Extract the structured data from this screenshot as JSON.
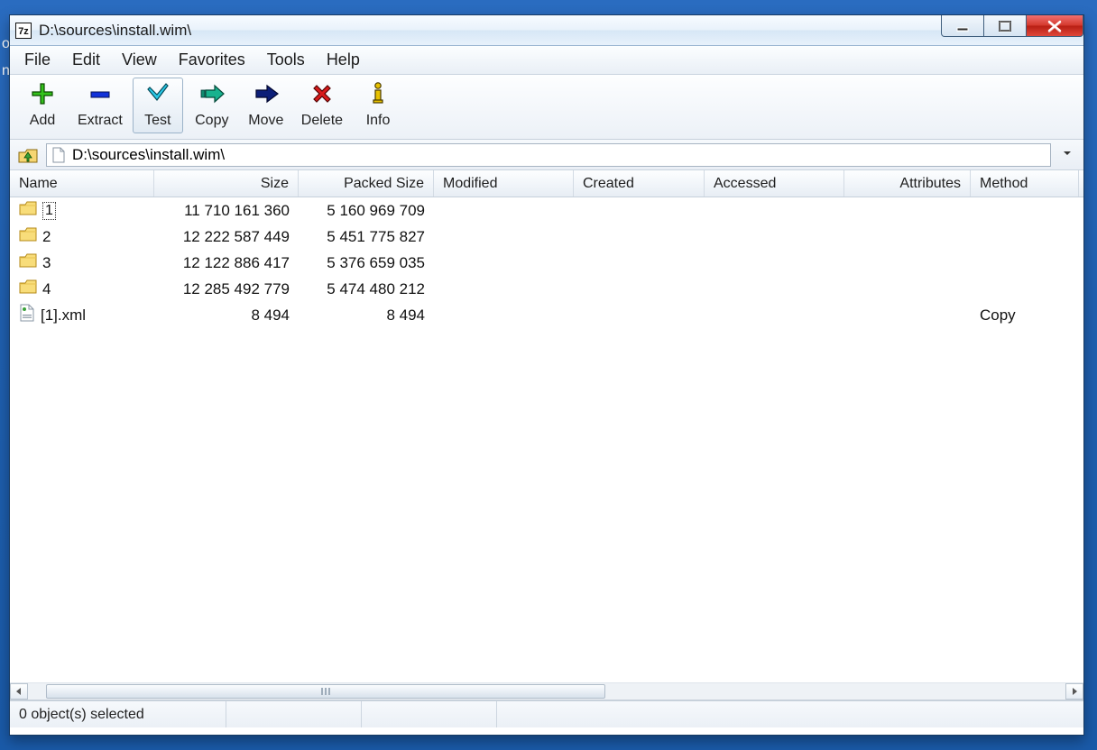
{
  "title": "D:\\sources\\install.wim\\",
  "menu": {
    "file": "File",
    "edit": "Edit",
    "view": "View",
    "favorites": "Favorites",
    "tools": "Tools",
    "help": "Help"
  },
  "toolbar": {
    "add": "Add",
    "extract": "Extract",
    "test": "Test",
    "copy": "Copy",
    "move": "Move",
    "delete": "Delete",
    "info": "Info"
  },
  "address_value": "D:\\sources\\install.wim\\",
  "columns": {
    "name": "Name",
    "size": "Size",
    "packed": "Packed Size",
    "modified": "Modified",
    "created": "Created",
    "accessed": "Accessed",
    "attributes": "Attributes",
    "method": "Method"
  },
  "rows": [
    {
      "icon": "folder",
      "name": "1",
      "selected": true,
      "size": "11 710 161 360",
      "packed": "5 160 969 709",
      "modified": "",
      "created": "",
      "accessed": "",
      "attributes": "",
      "method": ""
    },
    {
      "icon": "folder",
      "name": "2",
      "selected": false,
      "size": "12 222 587 449",
      "packed": "5 451 775 827",
      "modified": "",
      "created": "",
      "accessed": "",
      "attributes": "",
      "method": ""
    },
    {
      "icon": "folder",
      "name": "3",
      "selected": false,
      "size": "12 122 886 417",
      "packed": "5 376 659 035",
      "modified": "",
      "created": "",
      "accessed": "",
      "attributes": "",
      "method": ""
    },
    {
      "icon": "folder",
      "name": "4",
      "selected": false,
      "size": "12 285 492 779",
      "packed": "5 474 480 212",
      "modified": "",
      "created": "",
      "accessed": "",
      "attributes": "",
      "method": ""
    },
    {
      "icon": "xml",
      "name": "[1].xml",
      "selected": false,
      "size": "8 494",
      "packed": "8 494",
      "modified": "",
      "created": "",
      "accessed": "",
      "attributes": "",
      "method": "Copy"
    }
  ],
  "status": "0 object(s) selected"
}
